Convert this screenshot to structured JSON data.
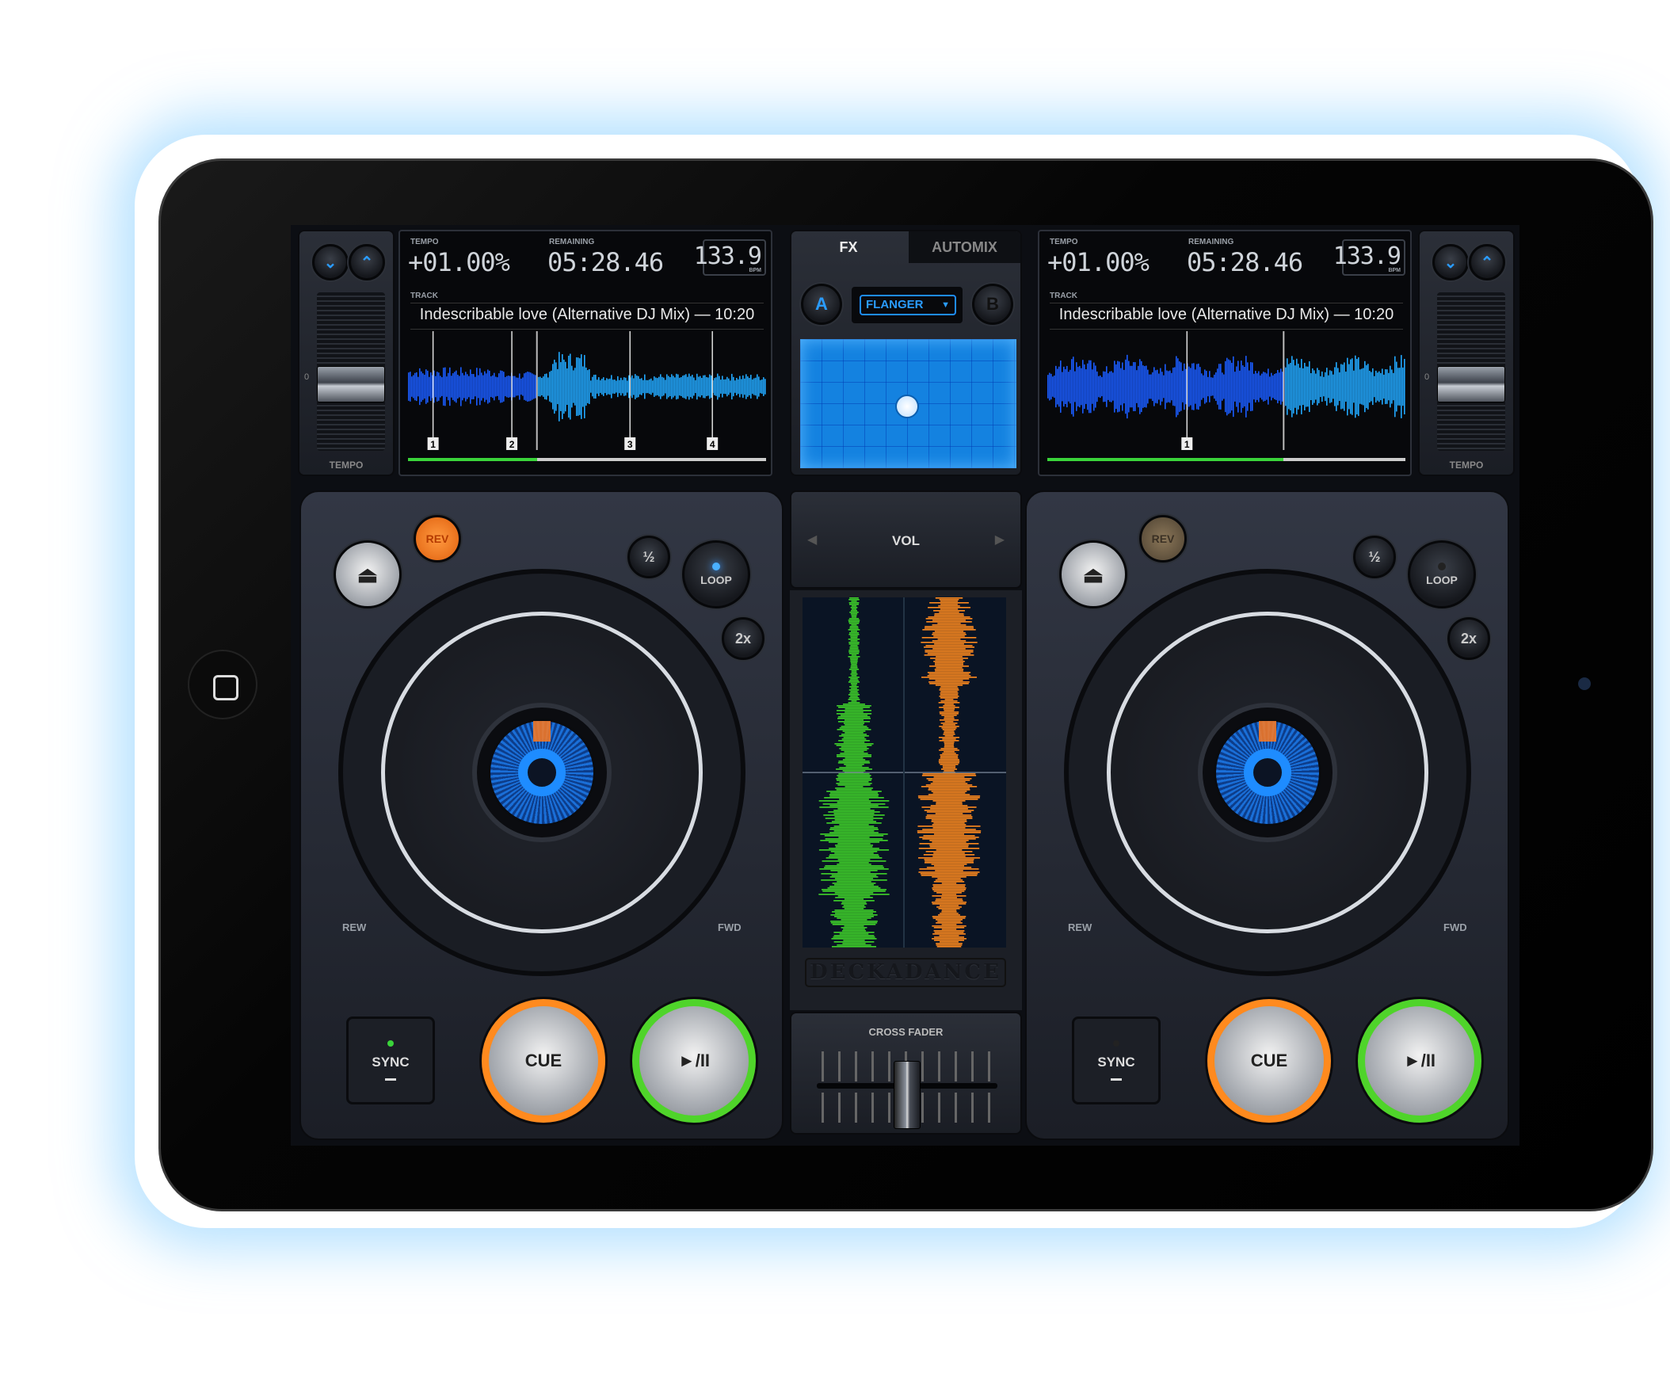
{
  "colors": {
    "accent_blue": "#1e8cff",
    "cue_orange": "#ff8a1e",
    "play_green": "#4fd42a",
    "rev_active": "#ff7a1e",
    "rev_inactive": "#6a5a44"
  },
  "fx": {
    "tabs": [
      {
        "label": "FX",
        "active": true
      },
      {
        "label": "AUTOMIX",
        "active": false
      }
    ],
    "deck_a": "A",
    "deck_b": "B",
    "effect": "FLANGER",
    "dropdown_icon": "caret-down-icon"
  },
  "mixer": {
    "vol_label": "VOL",
    "brand": "DECKADANCE",
    "crossfader_label": "CROSS FADER",
    "crossfader_position": 0.5
  },
  "decks": [
    {
      "tempo_label": "TEMPO",
      "tempo_value": "+01.00%",
      "remaining_label": "REMAINING",
      "remaining_value": "05:28.46",
      "bpm": "133.9",
      "bpm_unit": "BPM",
      "track_label": "TRACK",
      "track": "Indescribable love (Alternative DJ Mix) — 10:20",
      "cue_markers": [
        "1",
        "2",
        "3",
        "4"
      ],
      "progress": 0.36,
      "fader_label": "TEMPO",
      "fader_zero": "0",
      "rev": "REV",
      "rev_active": true,
      "half": "½",
      "loop": "LOOP",
      "loop_active": true,
      "double": "2x",
      "rew": "REW",
      "fwd": "FWD",
      "sync": "SYNC",
      "sync_active": true,
      "cue": "CUE",
      "play": "►/II"
    },
    {
      "tempo_label": "TEMPO",
      "tempo_value": "+01.00%",
      "remaining_label": "REMAINING",
      "remaining_value": "05:28.46",
      "bpm": "133.9",
      "bpm_unit": "BPM",
      "track_label": "TRACK",
      "track": "Indescribable love (Alternative DJ Mix) — 10:20",
      "cue_markers": [
        "1"
      ],
      "progress": 0.66,
      "fader_label": "TEMPO",
      "fader_zero": "0",
      "rev": "REV",
      "rev_active": false,
      "half": "½",
      "loop": "LOOP",
      "loop_active": false,
      "double": "2x",
      "rew": "REW",
      "fwd": "FWD",
      "sync": "SYNC",
      "sync_active": false,
      "cue": "CUE",
      "play": "►/II"
    }
  ]
}
